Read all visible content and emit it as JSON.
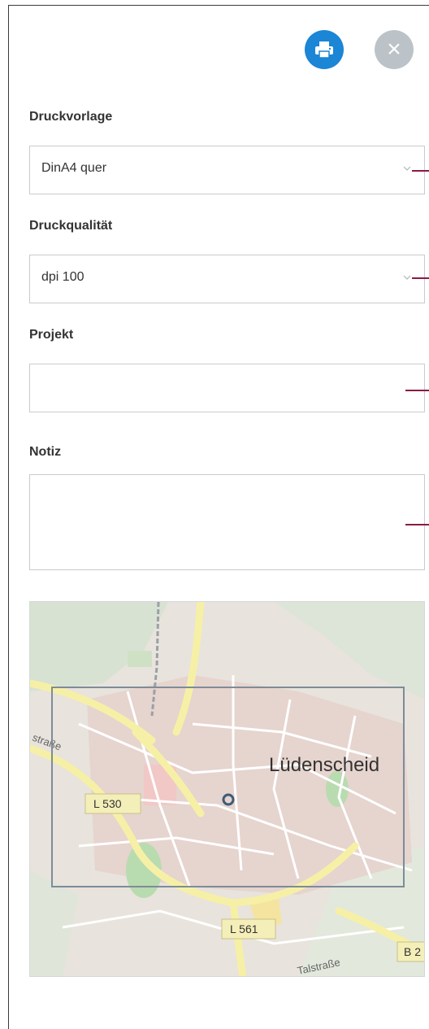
{
  "toolbar": {
    "print_icon": "printer-icon",
    "close_icon": "close-icon",
    "close_glyph": "×"
  },
  "form": {
    "template": {
      "label": "Druckvorlage",
      "value": "DinA4 quer"
    },
    "quality": {
      "label": "Druckqualität",
      "value": "dpi 100"
    },
    "project": {
      "label": "Projekt",
      "value": ""
    },
    "note": {
      "label": "Notiz",
      "value": ""
    }
  },
  "map": {
    "city_label": "Lüdenscheid",
    "road_labels": [
      "L 530",
      "L 561",
      "B 2",
      "Talstraße",
      "straße"
    ]
  },
  "colors": {
    "accent": "#1b85d6",
    "close_bg": "#bcc3c8",
    "marker": "#8b1a45"
  }
}
